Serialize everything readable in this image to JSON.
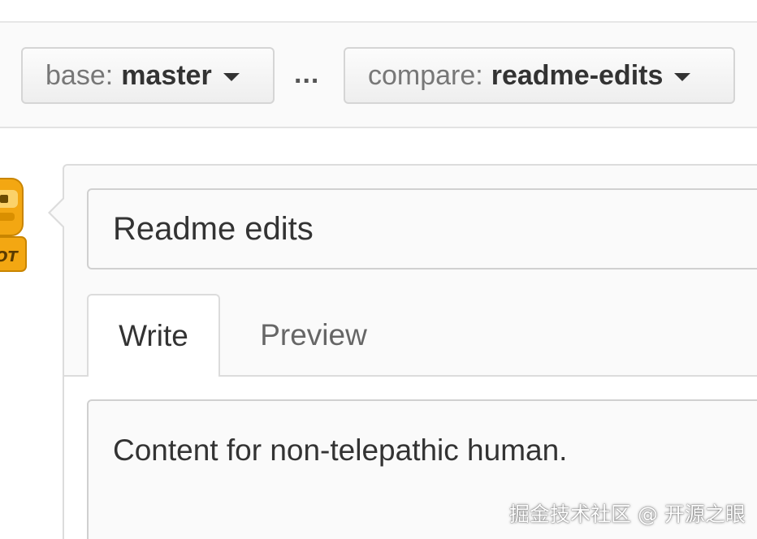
{
  "branch_bar": {
    "base": {
      "prefix": "base:",
      "name": "master"
    },
    "separator": "...",
    "compare": {
      "prefix": "compare:",
      "name": "readme-edits"
    }
  },
  "avatar": {
    "label": "OT",
    "icon": "octocat-robot-avatar-icon"
  },
  "pull_request": {
    "title_value": "Readme edits",
    "tabs": [
      {
        "label": "Write",
        "selected": true
      },
      {
        "label": "Preview",
        "selected": false
      }
    ],
    "body_value": "Content for non-telepathic human."
  },
  "watermark": "掘金技术社区 @ 开源之眼",
  "colors": {
    "bar_background": "#fafafa",
    "border": "#d5d5d5",
    "text": "#333333",
    "muted_text": "#777777",
    "avatar_orange": "#f3a712"
  }
}
